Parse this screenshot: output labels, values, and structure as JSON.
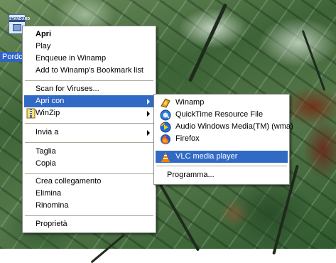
{
  "desktop": {
    "icon": {
      "badge_text": "STANDARD",
      "label": "Pordo"
    }
  },
  "context_menu": {
    "items": [
      {
        "label": "Apri"
      },
      {
        "label": "Play"
      },
      {
        "label": "Enqueue in Winamp"
      },
      {
        "label": "Add to Winamp's Bookmark list"
      },
      {
        "label": "Scan for Viruses..."
      },
      {
        "label": "Apri con"
      },
      {
        "label": "WinZip"
      },
      {
        "label": "Invia a"
      },
      {
        "label": "Taglia"
      },
      {
        "label": "Copia"
      },
      {
        "label": "Crea collegamento"
      },
      {
        "label": "Elimina"
      },
      {
        "label": "Rinomina"
      },
      {
        "label": "Proprietà"
      }
    ]
  },
  "open_with_submenu": {
    "items": [
      {
        "label": "Winamp",
        "icon": "winamp-icon"
      },
      {
        "label": "QuickTime Resource File",
        "icon": "quicktime-icon"
      },
      {
        "label": "Audio Windows Media(TM) (wma)",
        "icon": "windows-media-icon"
      },
      {
        "label": "Firefox",
        "icon": "firefox-icon"
      },
      {
        "label": "VLC media player",
        "icon": "vlc-icon"
      },
      {
        "label": "Programma...",
        "icon": ""
      }
    ]
  },
  "colors": {
    "selection": "#316ac5",
    "menu_background": "#ffffff",
    "separator": "#aca899"
  }
}
